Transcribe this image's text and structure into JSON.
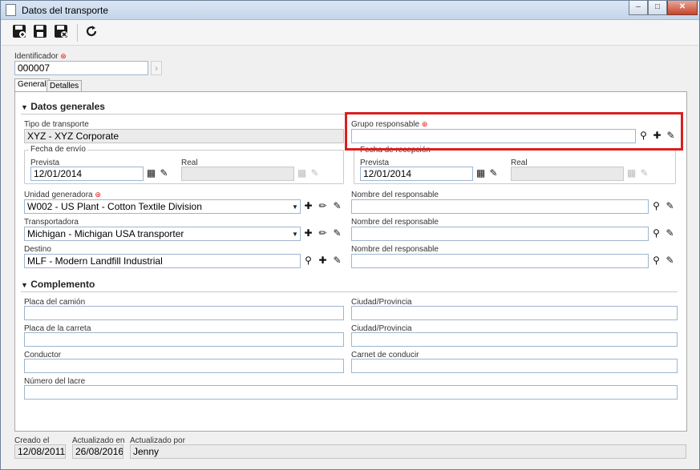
{
  "window": {
    "title": "Datos del transporte",
    "minimize": "–",
    "maximize": "□",
    "close": "✕"
  },
  "toolbar": {
    "icons": [
      "save-new-icon",
      "save-icon",
      "save-close-icon",
      "refresh-icon"
    ]
  },
  "identificador": {
    "label": "Identificador",
    "value": "000007"
  },
  "tabs": [
    {
      "label": "General"
    },
    {
      "label": "Detalles"
    }
  ],
  "datos_generales": {
    "title": "Datos generales",
    "tipo_transporte": {
      "label": "Tipo de transporte",
      "value": "XYZ - XYZ Corporate"
    },
    "grupo_responsable": {
      "label": "Grupo responsable",
      "value": ""
    },
    "fecha_envio": {
      "label": "Fecha de envío",
      "prevista_label": "Prevista",
      "prevista_value": "12/01/2014",
      "real_label": "Real",
      "real_value": ""
    },
    "fecha_recepcion": {
      "label": "Fecha de recepción",
      "prevista_label": "Prevista",
      "prevista_value": "12/01/2014",
      "real_label": "Real",
      "real_value": ""
    },
    "unidad_generadora": {
      "label": "Unidad generadora",
      "value": "W002 - US Plant - Cotton Textile Division"
    },
    "transportadora": {
      "label": "Transportadora",
      "value": "Michigan - Michigan USA transporter"
    },
    "destino": {
      "label": "Destino",
      "value": "MLF - Modern Landfill Industrial"
    },
    "nombre_responsable_1": {
      "label": "Nombre del responsable",
      "value": ""
    },
    "nombre_responsable_2": {
      "label": "Nombre del responsable",
      "value": ""
    },
    "nombre_responsable_3": {
      "label": "Nombre del responsable",
      "value": ""
    }
  },
  "complemento": {
    "title": "Complemento",
    "placa_camion": {
      "label": "Placa del camión",
      "value": ""
    },
    "ciudad_1": {
      "label": "Ciudad/Provincia",
      "value": ""
    },
    "placa_carreta": {
      "label": "Placa de la carreta",
      "value": ""
    },
    "ciudad_2": {
      "label": "Ciudad/Provincia",
      "value": ""
    },
    "conductor": {
      "label": "Conductor",
      "value": ""
    },
    "carnet": {
      "label": "Carnet de conducir",
      "value": ""
    },
    "numero_lacre": {
      "label": "Número del lacre",
      "value": ""
    }
  },
  "status": {
    "creado_label": "Creado el",
    "creado_value": "12/08/2011",
    "actualizado_en_label": "Actualizado en",
    "actualizado_en_value": "26/08/2016",
    "actualizado_por_label": "Actualizado por",
    "actualizado_por_value": "Jenny"
  },
  "colors": {
    "highlight": "#d8201f",
    "required": "#e00000",
    "field_border": "#9fb5cf"
  }
}
